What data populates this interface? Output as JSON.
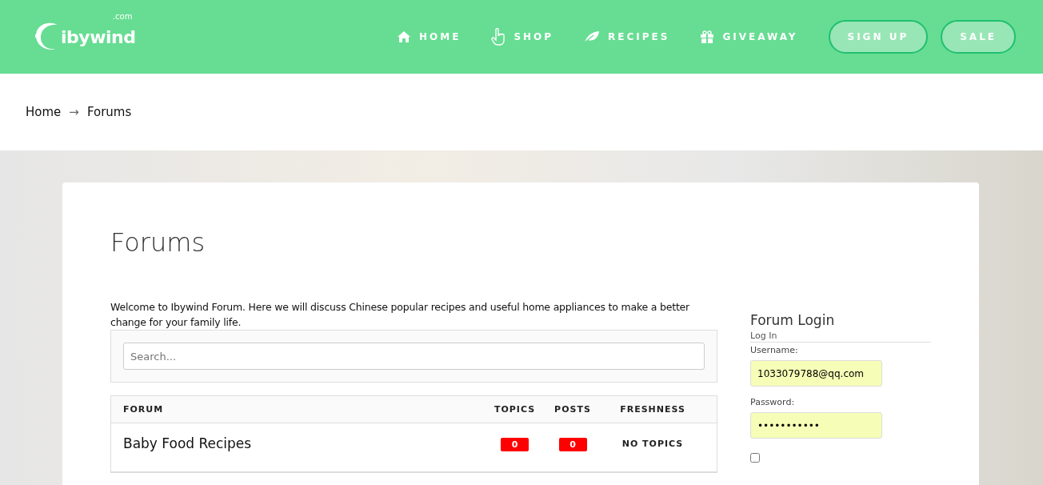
{
  "header": {
    "logo": {
      "name": "ibywind",
      "suffix": ".com"
    },
    "nav": [
      {
        "label": "HOME"
      },
      {
        "label": "SHOP"
      },
      {
        "label": "RECIPES"
      },
      {
        "label": "GIVEAWAY"
      }
    ],
    "buttons": [
      "SIGN UP",
      "SALE"
    ]
  },
  "breadcrumb": {
    "items": [
      "Home",
      "Forums"
    ],
    "separator": "→"
  },
  "page": {
    "title": "Forums",
    "intro": "Welcome to Ibywind Forum. Here we will discuss Chinese popular recipes and useful home appliances to make a better change for your family life.",
    "search": {
      "placeholder": "Search..."
    },
    "table": {
      "columns": [
        "FORUM",
        "TOPICS",
        "POSTS",
        "FRESHNESS"
      ],
      "rows": [
        {
          "forum": "Baby Food Recipes",
          "topics": "0",
          "posts": "0",
          "freshness": "NO TOPICS"
        }
      ]
    }
  },
  "login": {
    "title": "Forum Login",
    "subtitle": "Log In",
    "username_label": "Username:",
    "username": "1033079788@qq.com",
    "password_label": "Password:",
    "password": "•••••••••••",
    "remember_checked": false
  }
}
